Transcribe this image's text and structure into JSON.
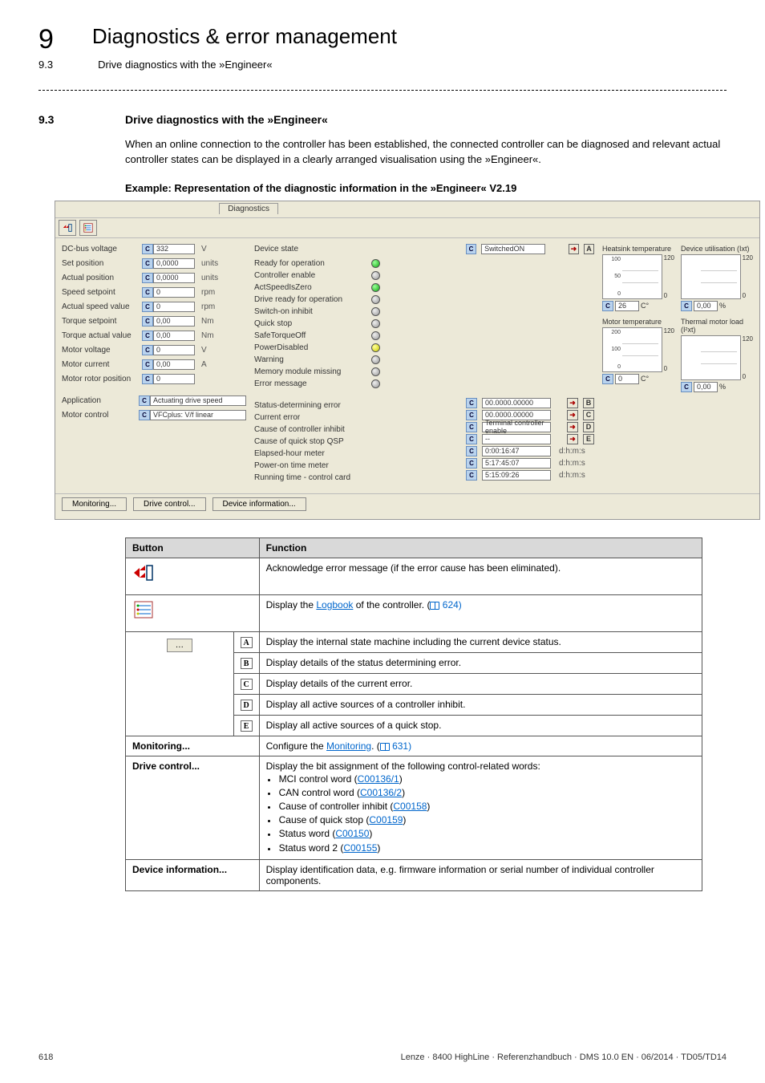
{
  "chapter": {
    "number": "9",
    "title": "Diagnostics & error management"
  },
  "subheader": {
    "number": "9.3",
    "title": "Drive diagnostics with the »Engineer«"
  },
  "section": {
    "number": "9.3",
    "title": "Drive diagnostics with the »Engineer«"
  },
  "intro": "When an online connection to the controller has been established, the connected controller can be diagnosed and relevant actual controller states can be displayed in a clearly arranged visualisation using the »Engineer«.",
  "example_caption": "Example: Representation of the diagnostic information in the »Engineer« V2.19",
  "engineer": {
    "tab": "Diagnostics",
    "left": [
      {
        "label": "DC-bus voltage",
        "value": "332",
        "unit": "V"
      },
      {
        "label": "Set position",
        "value": "0,0000",
        "unit": "units"
      },
      {
        "label": "Actual position",
        "value": "0,0000",
        "unit": "units"
      },
      {
        "label": "Speed setpoint",
        "value": "0",
        "unit": "rpm"
      },
      {
        "label": "Actual speed value",
        "value": "0",
        "unit": "rpm"
      },
      {
        "label": "Torque setpoint",
        "value": "0,00",
        "unit": "Nm"
      },
      {
        "label": "Torque actual value",
        "value": "0,00",
        "unit": "Nm"
      },
      {
        "label": "Motor voltage",
        "value": "0",
        "unit": "V"
      },
      {
        "label": "Motor current",
        "value": "0,00",
        "unit": "A"
      },
      {
        "label": "Motor rotor position",
        "value": "0",
        "unit": ""
      }
    ],
    "left_extra": [
      {
        "label": "Application",
        "value": "Actuating drive speed"
      },
      {
        "label": "Motor control",
        "value": "VFCplus: V/f linear"
      }
    ],
    "mid_top": {
      "label": "Device state",
      "value": "SwitchedON",
      "letter": "A"
    },
    "mid_items": [
      {
        "label": "Ready for operation",
        "led": "green"
      },
      {
        "label": "Controller enable",
        "led": "grey"
      },
      {
        "label": "ActSpeedIsZero",
        "led": "green"
      },
      {
        "label": "Drive ready for operation",
        "led": "grey"
      },
      {
        "label": "Switch-on inhibit",
        "led": "grey"
      },
      {
        "label": "Quick stop",
        "led": "grey"
      },
      {
        "label": "SafeTorqueOff",
        "led": "grey"
      },
      {
        "label": "PowerDisabled",
        "led": "yellow"
      },
      {
        "label": "Warning",
        "led": "grey"
      },
      {
        "label": "Memory module missing",
        "led": "grey"
      },
      {
        "label": "Error message",
        "led": "grey"
      }
    ],
    "mid_bottom": [
      {
        "label": "Status-determining error",
        "value": "00.0000.00000",
        "letter": "B"
      },
      {
        "label": "Current error",
        "value": "00.0000.00000",
        "letter": "C"
      },
      {
        "label": "Cause of controller inhibit",
        "value": "Terminal controller enable",
        "letter": "D"
      },
      {
        "label": "Cause of quick stop QSP",
        "value": "--",
        "letter": "E"
      },
      {
        "label": "Elapsed-hour meter",
        "value": "0:00:16:47",
        "unit": "d:h:m:s"
      },
      {
        "label": "Power-on time meter",
        "value": "5:17:45:07",
        "unit": "d:h:m:s"
      },
      {
        "label": "Running time - control card",
        "value": "5:15:09:26",
        "unit": "d:h:m:s"
      }
    ],
    "gauges": [
      {
        "title": "Heatsink temperature",
        "scale": [
          "100",
          "50",
          "0"
        ],
        "out": "26",
        "unit": "C°",
        "max": "120"
      },
      {
        "title": "Device utilisation (Ixt)",
        "scale": [
          "",
          "",
          ""
        ],
        "out": "0,00",
        "unit": "%",
        "max": "120"
      },
      {
        "title": "Motor temperature",
        "scale": [
          "200",
          "100",
          "0"
        ],
        "out": "0",
        "unit": "C°",
        "max": "120"
      },
      {
        "title": "Thermal motor load (I²xt)",
        "scale": [
          "",
          "",
          ""
        ],
        "out": "0,00",
        "unit": "%",
        "max": "120"
      }
    ],
    "buttons": [
      "Monitoring...",
      "Drive control...",
      "Device information..."
    ]
  },
  "table": {
    "headers": [
      "Button",
      "Function"
    ],
    "rows": {
      "ack": "Acknowledge error message (if the error cause has been eliminated).",
      "logbook_pre": "Display the ",
      "logbook_link": "Logbook",
      "logbook_post": " of the controller. (",
      "logbook_page": " 624)",
      "A": "Display the internal state machine including the current device status.",
      "B": "Display details of the status determining error.",
      "C": "Display details of the current error.",
      "D": "Display all active sources of a controller inhibit.",
      "E": "Display all active sources of a quick stop.",
      "monitoring_label": "Monitoring...",
      "monitoring_pre": "Configure the ",
      "monitoring_link": "Monitoring",
      "monitoring_post": ". (",
      "monitoring_page": " 631)",
      "drive_label": "Drive control...",
      "drive_intro": "Display the bit assignment of the following control-related words:",
      "drive_items": [
        {
          "text": "MCI control word (",
          "link": "C00136/1",
          "post": ")"
        },
        {
          "text": "CAN control word (",
          "link": "C00136/2",
          "post": ")"
        },
        {
          "text": "Cause of controller inhibit (",
          "link": "C00158",
          "post": ")"
        },
        {
          "text": "Cause of quick stop (",
          "link": "C00159",
          "post": ")"
        },
        {
          "text": "Status word (",
          "link": "C00150",
          "post": ")"
        },
        {
          "text": "Status word 2 (",
          "link": "C00155",
          "post": ")"
        }
      ],
      "devinfo_label": "Device information...",
      "devinfo": "Display identification data, e.g. firmware information or serial number of individual controller components."
    }
  },
  "footer": {
    "page": "618",
    "meta": "Lenze · 8400 HighLine · Referenzhandbuch · DMS 10.0 EN · 06/2014 · TD05/TD14"
  },
  "letters": [
    "A",
    "B",
    "C",
    "D",
    "E"
  ]
}
